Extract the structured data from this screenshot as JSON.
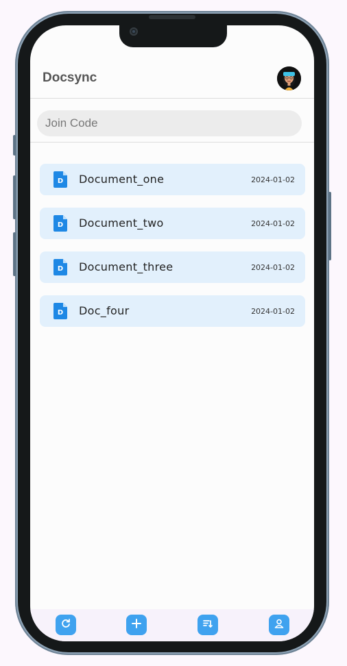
{
  "app": {
    "title": "Docsync"
  },
  "join": {
    "placeholder": "Join Code",
    "value": ""
  },
  "documents": [
    {
      "name": "Document_one",
      "date": "2024-01-02"
    },
    {
      "name": "Document_two",
      "date": "2024-01-02"
    },
    {
      "name": "Document_three",
      "date": "2024-01-02"
    },
    {
      "name": "Doc_four",
      "date": "2024-01-02"
    }
  ],
  "doc_icon_letter": "D",
  "bottom_nav": [
    {
      "icon": "refresh-icon"
    },
    {
      "icon": "add-icon"
    },
    {
      "icon": "sort-icon"
    },
    {
      "icon": "profile-icon"
    }
  ],
  "colors": {
    "accent": "#3fa2ef",
    "doc_card": "#e2f0fc",
    "doc_icon": "#1e88e5",
    "frame": "#8fa4b7"
  }
}
